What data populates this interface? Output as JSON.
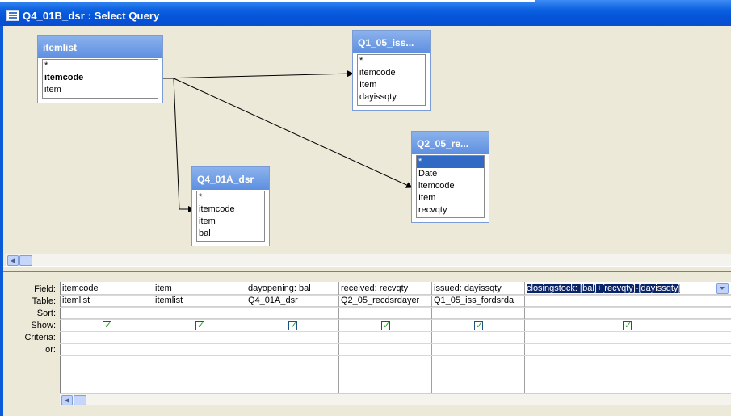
{
  "window": {
    "title": "Q4_01B_dsr : Select Query"
  },
  "tables": [
    {
      "title": "itemlist",
      "fields": [
        "*",
        "itemcode",
        "item"
      ],
      "bold_field": 1,
      "selected_field": -1
    },
    {
      "title": "Q1_05_iss...",
      "fields": [
        "*",
        "itemcode",
        "Item",
        "dayissqty"
      ],
      "bold_field": -1,
      "selected_field": -1
    },
    {
      "title": "Q2_05_re...",
      "fields": [
        "*",
        "Date",
        "itemcode",
        "Item",
        "recvqty"
      ],
      "bold_field": -1,
      "selected_field": 0
    },
    {
      "title": "Q4_01A_dsr",
      "fields": [
        "*",
        "itemcode",
        "item",
        "bal"
      ],
      "bold_field": -1,
      "selected_field": -1
    }
  ],
  "grid": {
    "row_labels": [
      "Field:",
      "Table:",
      "Sort:",
      "Show:",
      "Criteria:",
      "or:"
    ],
    "columns": [
      {
        "field": "itemcode",
        "table": "itemlist",
        "show": true
      },
      {
        "field": "item",
        "table": "itemlist",
        "show": true
      },
      {
        "field": "dayopening: bal",
        "table": "Q4_01A_dsr",
        "show": true
      },
      {
        "field": "received: recvqty",
        "table": "Q2_05_recdsrdayer",
        "show": true
      },
      {
        "field": "issued: dayissqty",
        "table": "Q1_05_iss_fordsrda",
        "show": true
      },
      {
        "field": "closingstock: [bal]+[recvqty]-[dayissqty]",
        "table": "",
        "show": true
      }
    ]
  },
  "icons": {
    "window": "query-window-icon",
    "scroll_left": "scroll-left-arrow-icon",
    "dropdown": "dropdown-arrow-icon"
  },
  "colors": {
    "titlebar": "#0553d6",
    "table_header": "#7aa5e8",
    "selection": "#316ac5",
    "background": "#ece9d8"
  }
}
